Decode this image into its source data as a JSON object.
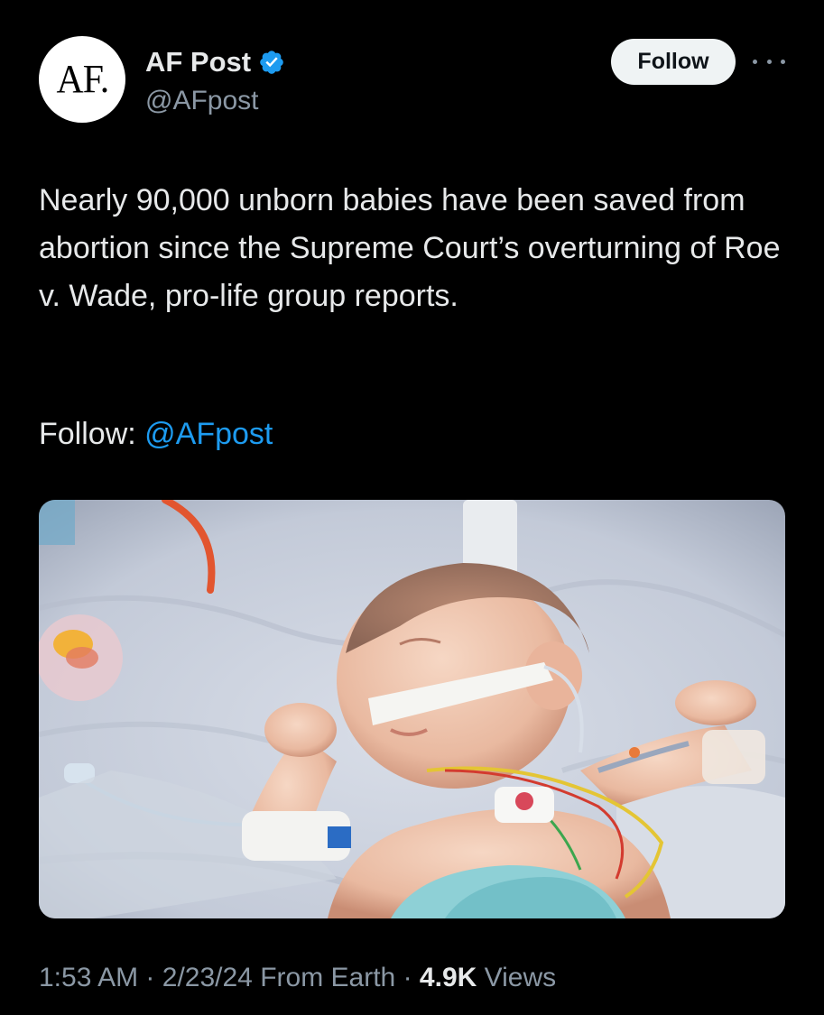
{
  "author": {
    "avatar_text": "AF.",
    "display_name": "AF Post",
    "handle": "@AFpost",
    "verified": true
  },
  "follow_button_label": "Follow",
  "more_icon": "more-options-icon",
  "tweet": {
    "text": "Nearly 90,000 unborn babies have been saved from abortion since the Supreme Court’s overturning of Roe v. Wade, pro-life group reports.",
    "follow_prefix": "Follow:",
    "follow_mention": "@AFpost"
  },
  "meta": {
    "time": "1:53 AM",
    "date": "2/23/24",
    "source": "From Earth",
    "views_count": "4.9K",
    "views_label": "Views",
    "separator": "·"
  },
  "colors": {
    "background": "#000000",
    "text": "#e7e9ea",
    "secondary": "#8b98a5",
    "link": "#1d9bf0",
    "verified": "#1d9bf0"
  }
}
